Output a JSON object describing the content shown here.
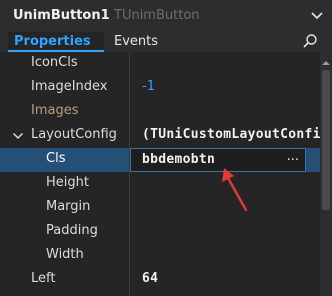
{
  "header": {
    "component_name": "UnimButton1",
    "component_type": "TUnimButton"
  },
  "tabs": [
    {
      "label": "Properties",
      "active": true
    },
    {
      "label": "Events",
      "active": false
    }
  ],
  "properties": [
    {
      "name": "IconCls",
      "value": ""
    },
    {
      "name": "ImageIndex",
      "value": "-1"
    },
    {
      "name": "Images",
      "value": ""
    },
    {
      "name": "LayoutConfig",
      "value": "(TUniCustomLayoutConfig)",
      "expanded": true
    },
    {
      "name": "Cls",
      "value": "bbdemobtn",
      "selected": true,
      "editor_button": "..."
    },
    {
      "name": "Height",
      "value": ""
    },
    {
      "name": "Margin",
      "value": ""
    },
    {
      "name": "Padding",
      "value": ""
    },
    {
      "name": "Width",
      "value": ""
    },
    {
      "name": "Left",
      "value": "64"
    }
  ],
  "colors": {
    "accent": "#2ea3ff",
    "selection": "#264f78",
    "annotation_arrow": "#e53935"
  },
  "icons": {
    "title_chevron": "chevron-down-icon",
    "search": "search-icon",
    "expand": "chevron-down-icon",
    "scroll_up": "scroll-up-arrow-icon"
  }
}
